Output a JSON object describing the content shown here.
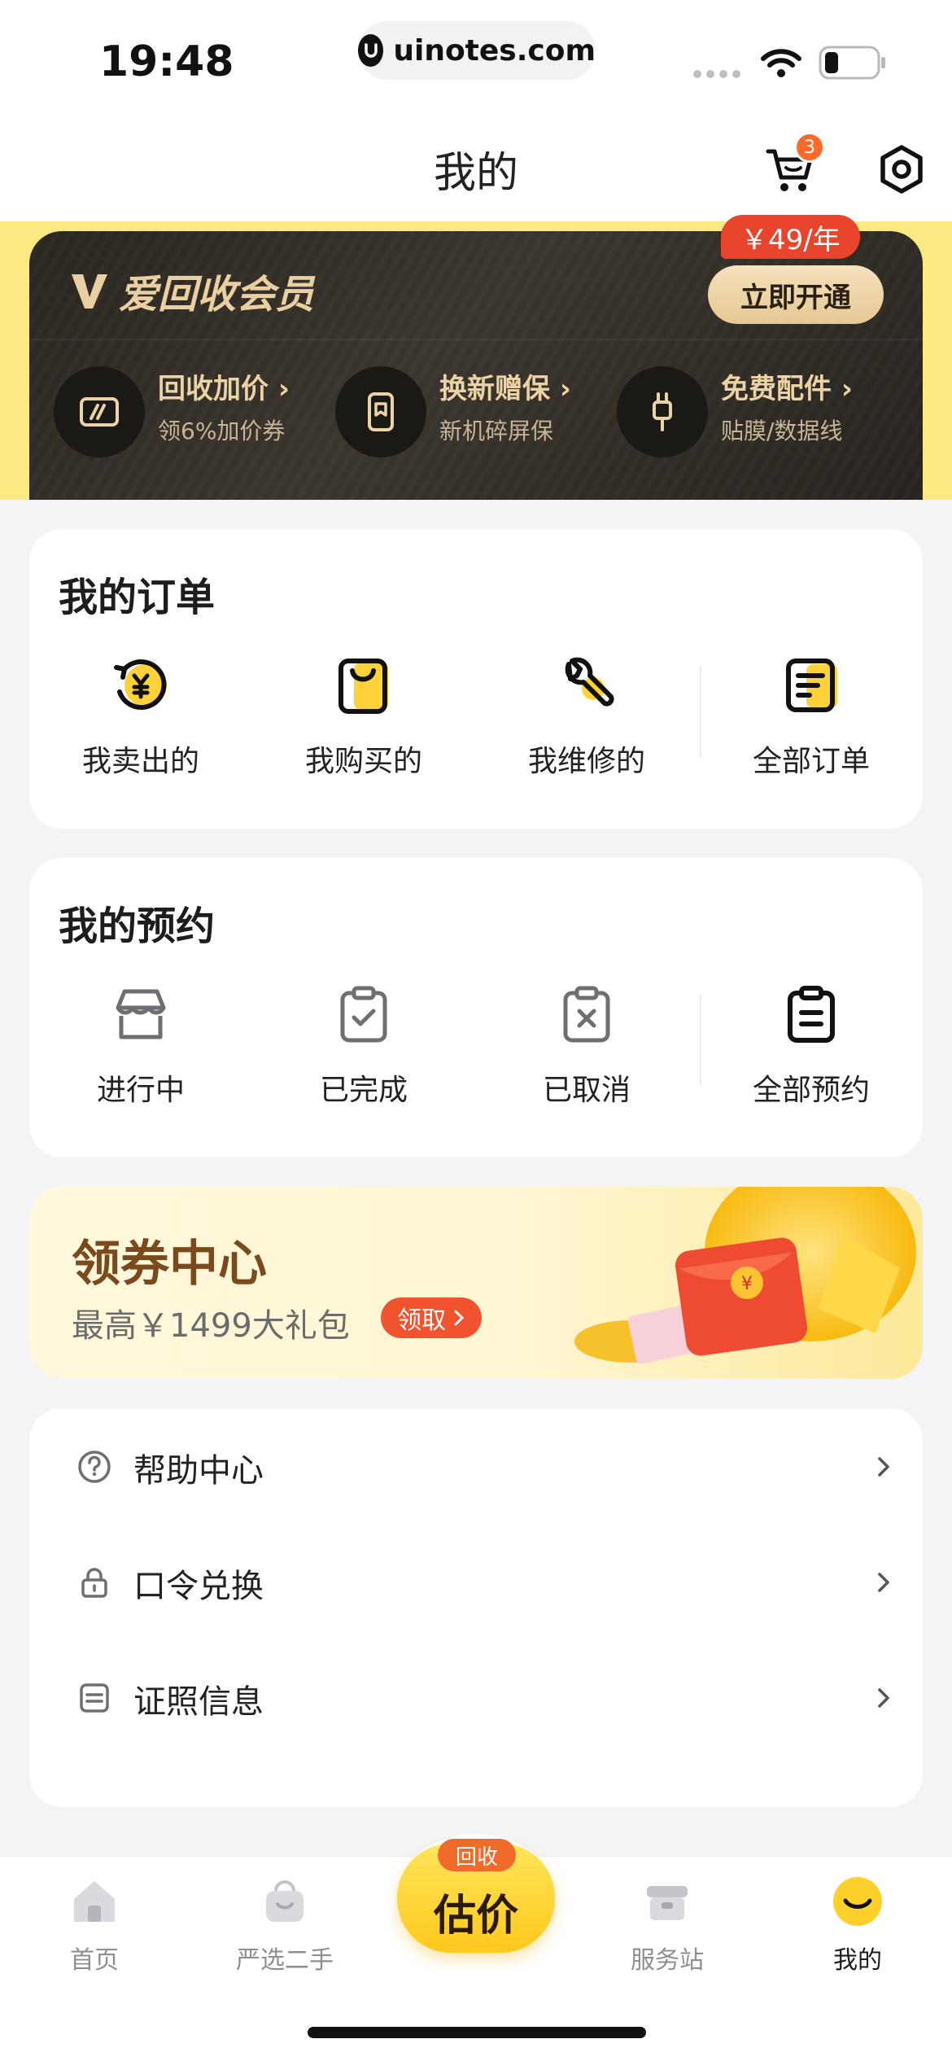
{
  "status_bar": {
    "time": "19:48",
    "url": "uinotes.com"
  },
  "nav": {
    "title": "我的",
    "cart_count": "3"
  },
  "vip": {
    "title": "爱回收会员",
    "price_tag": "￥49/年",
    "open_label": "立即开通",
    "benefits": [
      {
        "title": "回收加价 ›",
        "subtitle": "领6%加价券",
        "icon": "ticket-icon"
      },
      {
        "title": "换新赠保 ›",
        "subtitle": "新机碎屏保",
        "icon": "phone-shield-icon"
      },
      {
        "title": "免费配件 ›",
        "subtitle": "贴膜/数据线",
        "icon": "cable-icon"
      }
    ]
  },
  "orders": {
    "title": "我的订单",
    "items": [
      {
        "label": "我卖出的",
        "icon": "yuan-recycle-icon"
      },
      {
        "label": "我购买的",
        "icon": "shopping-bag-icon"
      },
      {
        "label": "我维修的",
        "icon": "wrench-icon"
      },
      {
        "label": "全部订单",
        "icon": "order-list-icon"
      }
    ]
  },
  "appointments": {
    "title": "我的预约",
    "items": [
      {
        "label": "进行中",
        "icon": "store-icon"
      },
      {
        "label": "已完成",
        "icon": "clipboard-check-icon"
      },
      {
        "label": "已取消",
        "icon": "clipboard-x-icon"
      },
      {
        "label": "全部预约",
        "icon": "clipboard-list-icon"
      }
    ]
  },
  "coupon": {
    "title": "领券中心",
    "subtitle": "最高￥1499大礼包",
    "button_label": "领取"
  },
  "menu": [
    {
      "label": "帮助中心",
      "icon": "question-circle-icon"
    },
    {
      "label": "口令兑换",
      "icon": "lock-icon"
    },
    {
      "label": "证照信息",
      "icon": "license-icon"
    }
  ],
  "tabbar": {
    "tabs": [
      {
        "label": "首页",
        "icon": "home-icon"
      },
      {
        "label": "严选二手",
        "icon": "bag-icon"
      },
      {
        "label": "服务站",
        "icon": "service-station-icon"
      },
      {
        "label": "我的",
        "icon": "smiley-icon"
      }
    ],
    "center": {
      "badge": "回收",
      "label": "估价"
    }
  },
  "colors": {
    "accent_yellow": "#ffd02a",
    "vip_gold": "#e9cfa2",
    "price_red": "#e8452c",
    "coupon_brown": "#7a4a1c"
  }
}
